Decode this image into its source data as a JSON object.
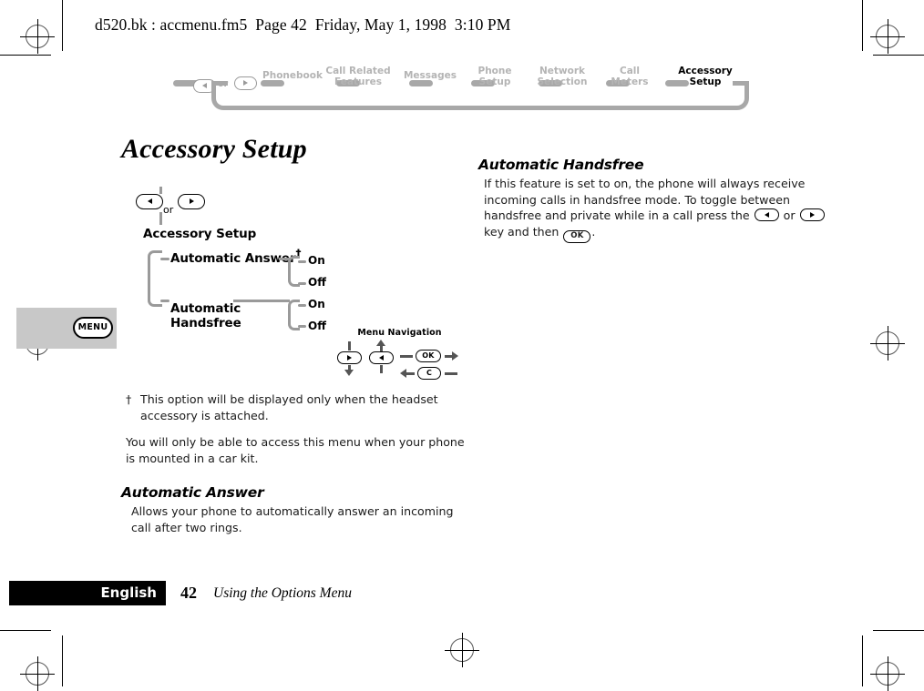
{
  "document": {
    "header_line": "d520.bk : accmenu.fm5  Page 42  Friday, May 1, 1998  3:10 PM",
    "title": "Accessory Setup"
  },
  "breadcrumb": {
    "or_label": "or",
    "items": [
      {
        "label": "Phonebook",
        "current": false
      },
      {
        "label": "Call Related\nFeatures",
        "current": false
      },
      {
        "label": "Messages",
        "current": false
      },
      {
        "label": "Phone\nSetup",
        "current": false
      },
      {
        "label": "Network\nSelection",
        "current": false
      },
      {
        "label": "Call\nMeters",
        "current": false
      },
      {
        "label": "Accessory\nSetup",
        "current": true
      }
    ]
  },
  "side_tab": {
    "key_label": "MENU"
  },
  "menu_tree": {
    "or_label": "or",
    "root": "Accessory Setup",
    "branches": [
      {
        "label": "Automatic Answer",
        "dagger": "†",
        "options": [
          "On",
          "Off"
        ]
      },
      {
        "label": "Automatic\nHandsfree",
        "dagger": "",
        "options": [
          "On",
          "Off"
        ]
      }
    ]
  },
  "menu_navigation": {
    "title": "Menu Navigation",
    "keys": [
      {
        "name": "down-key",
        "glyph": "right-triangle"
      },
      {
        "name": "up-key",
        "glyph": "left-triangle"
      },
      {
        "name": "ok-key",
        "glyph": "OK"
      },
      {
        "name": "clear-key",
        "glyph": "C"
      }
    ]
  },
  "footnotes": {
    "mark": "†",
    "dagger_text": "This option will be displayed only when the headset accessory is attached.",
    "car_kit_text": "You will only be able to access this menu when your phone is mounted in a car kit."
  },
  "sections": {
    "automatic_answer": {
      "heading": "Automatic Answer",
      "body": "Allows your phone to automatically answer an incoming call after two rings."
    },
    "automatic_handsfree": {
      "heading": "Automatic Handsfree",
      "body_part1": "If this feature is set to on, the phone will always receive incoming calls in handsfree mode. To toggle between handsfree and private while in a call press the ",
      "or_label": " or ",
      "body_part2": " key and then ",
      "ok_label": "OK",
      "body_end": "."
    }
  },
  "footer": {
    "language": "English",
    "page_number": "42",
    "section_title": "Using the Options Menu"
  }
}
